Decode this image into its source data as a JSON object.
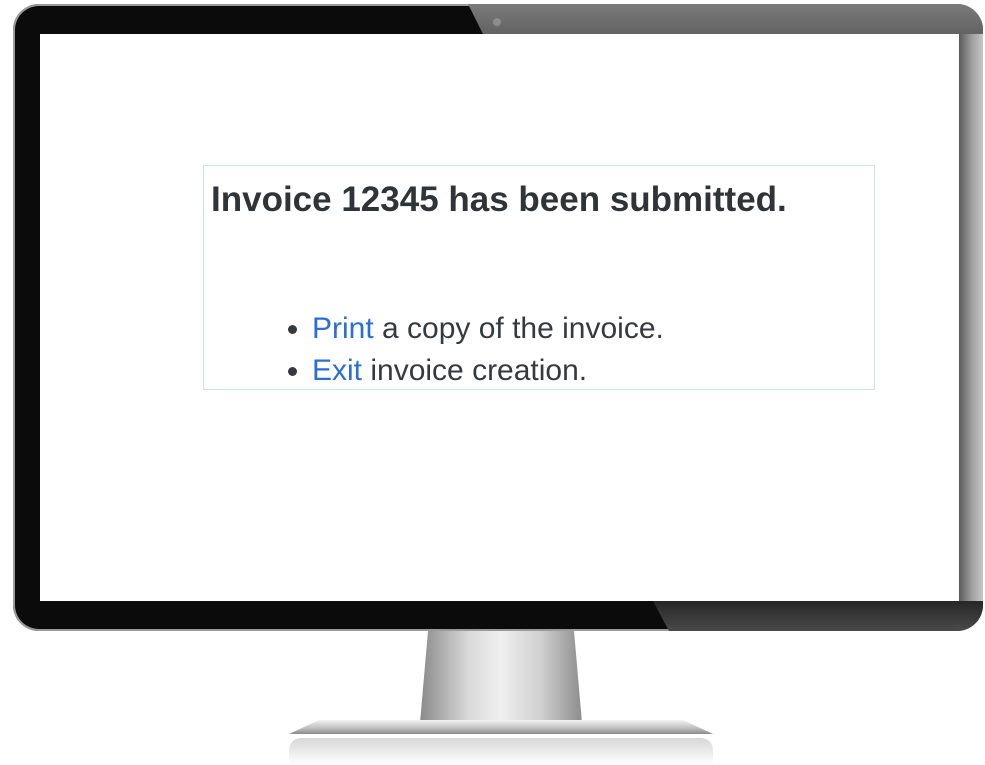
{
  "dialog": {
    "title": "Invoice 12345 has been submitted.",
    "items": [
      {
        "link": "Print",
        "text": " a copy of the invoice."
      },
      {
        "link": "Exit",
        "text": " invoice creation."
      }
    ]
  },
  "colors": {
    "link": "#2a6fd6",
    "text": "#2f3439",
    "panel_border": "#cfe3e6",
    "bezel": "#0b0b0b"
  }
}
